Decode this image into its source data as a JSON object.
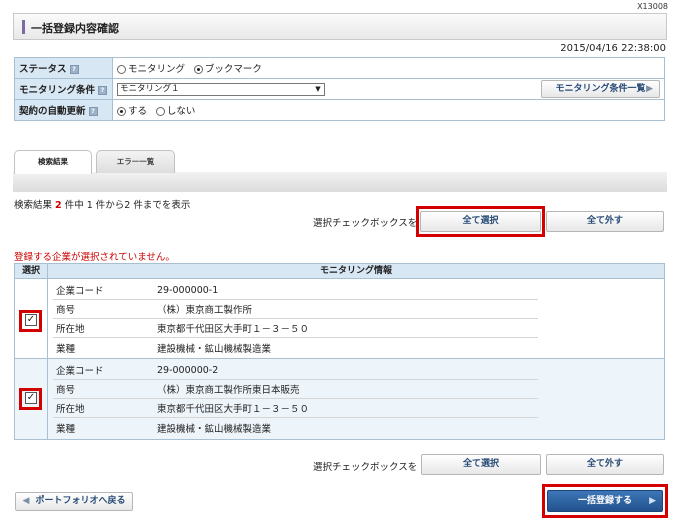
{
  "screen_id": "X13008",
  "page_title": "一括登録内容確認",
  "datetime": "2015/04/16 22:38:00",
  "conditions": {
    "status_label": "ステータス",
    "status_options": [
      "モニタリング",
      "ブックマーク"
    ],
    "status_selected": "ブックマーク",
    "monitoring_label": "モニタリング条件",
    "monitoring_value": "モニタリング１",
    "monitoring_list_button": "モニタリング条件一覧",
    "auto_renew_label": "契約の自動更新",
    "auto_renew_options": [
      "する",
      "しない"
    ],
    "auto_renew_selected": "する",
    "help_icon": "?"
  },
  "tabs": [
    "検索結果",
    "エラー一覧"
  ],
  "result_count": {
    "prefix": "検索結果",
    "total": "2",
    "suffix": "件中 1 件から2 件までを表示"
  },
  "selection": {
    "label": "選択チェックボックスを",
    "select_all": "全て選択",
    "deselect_all": "全て外す"
  },
  "error_message": "登録する企業が選択されていません。",
  "grid": {
    "headers": [
      "選択",
      "モニタリング情報"
    ],
    "field_labels": [
      "企業コード",
      "商号",
      "所在地",
      "業種"
    ],
    "rows": [
      {
        "checked": true,
        "values": [
          "29-000000-1",
          "（株）東京商工製作所",
          "東京都千代田区大手町１－３－５０",
          "建設機械・鉱山機械製造業"
        ]
      },
      {
        "checked": true,
        "values": [
          "29-000000-2",
          "（株）東京商工製作所東日本販売",
          "東京都千代田区大手町１－３－５０",
          "建設機械・鉱山機械製造業"
        ]
      }
    ]
  },
  "footer": {
    "back_button": "ポートフォリオへ戻る",
    "register_button": "一括登録する"
  },
  "colors": {
    "accent_red": "#d40000",
    "header_blue": "#d7e7f4",
    "primary_button": "#2a5d98"
  }
}
